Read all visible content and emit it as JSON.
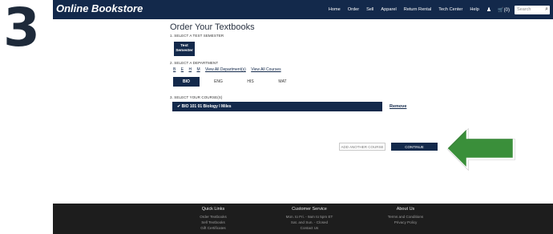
{
  "step": {
    "number": "3"
  },
  "header": {
    "brand": "Online Bookstore",
    "nav": [
      "Home",
      "Order",
      "Sell",
      "Apparel",
      "Return Rental",
      "Tech Center",
      "Help"
    ],
    "cart_label": "(0)",
    "search_placeholder": "Search"
  },
  "page": {
    "title": "Order Your Textbooks",
    "section1": "1. SELECT A TEST SEMESTER",
    "semester_line1": "Test",
    "semester_line2": "Semester",
    "section2": "2. SELECT A DEPARTMENT",
    "letters": [
      "B",
      "E",
      "H",
      "M"
    ],
    "view_all_departments": "View All Department(s)",
    "view_all_courses": "View All Courses",
    "departments": [
      "BIO",
      "ENG",
      "HIS",
      "MAT"
    ],
    "selected_department": "BIO",
    "section3": "3. SELECT YOUR COURSE(S)",
    "course": "✔ BIO 101 01  Biology I Miles",
    "remove": "Remove",
    "add_another": "ADD ANOTHER COURSE",
    "continue": "CONTINUE"
  },
  "colors": {
    "navy": "#13294b",
    "arrow_green": "#3a8f3a",
    "footer": "#1d1d1d"
  },
  "footer": {
    "quick_links": {
      "title": "Quick Links",
      "links": [
        "Order Textbooks",
        "Sell Textbooks",
        "Gift Certificates"
      ]
    },
    "customer_service": {
      "title": "Customer Service",
      "lines": [
        "Mon. to Fri. - 9am to 5pm ET",
        "Sat. and Sun. - Closed",
        "Contact Us"
      ]
    },
    "about_us": {
      "title": "About Us",
      "links": [
        "Terms and Conditions",
        "Privacy Policy"
      ]
    }
  }
}
